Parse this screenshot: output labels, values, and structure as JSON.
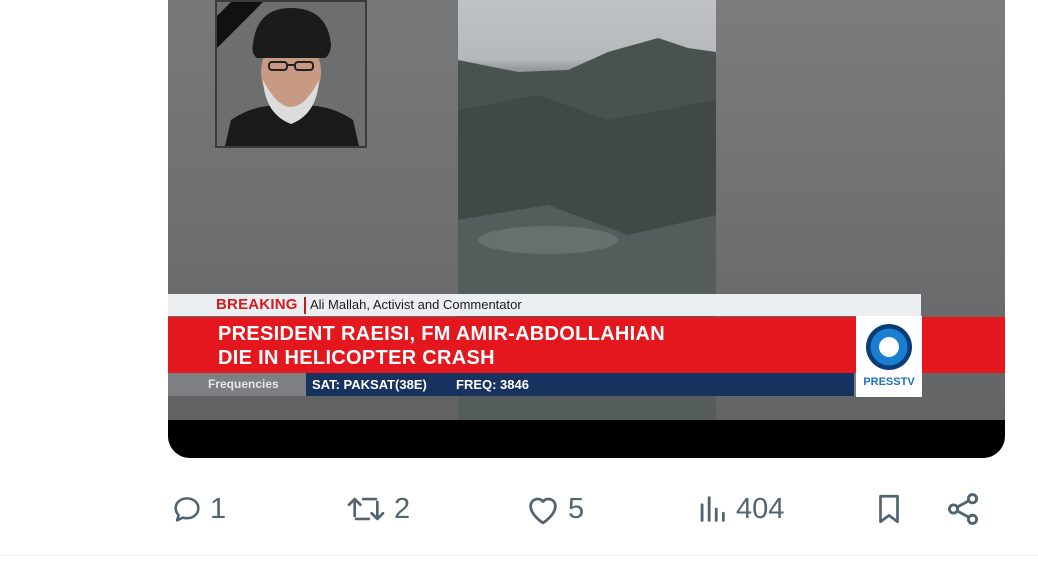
{
  "media": {
    "banner": {
      "breaking_label": "BREAKING",
      "guest_text": "Ali Mallah, Activist and Commentator",
      "headline_line1": "PRESIDENT RAEISI, FM AMIR-ABDOLLAHIAN",
      "headline_line2": "DIE IN HELICOPTER CRASH",
      "frequencies_label": "Frequencies",
      "sat_text": "SAT: PAKSAT(38E)",
      "freq_text": "FREQ: 3846",
      "channel_logo_text": "PRESSTV"
    },
    "colors": {
      "banner_red": "#e4161e",
      "banner_navy": "#17325e",
      "logo_blue": "#1d6fc2"
    }
  },
  "actions": {
    "reply_count": "1",
    "repost_count": "2",
    "like_count": "5",
    "views_count": "404",
    "icons": [
      "reply-icon",
      "repost-icon",
      "like-icon",
      "views-icon",
      "bookmark-icon",
      "share-icon"
    ]
  }
}
